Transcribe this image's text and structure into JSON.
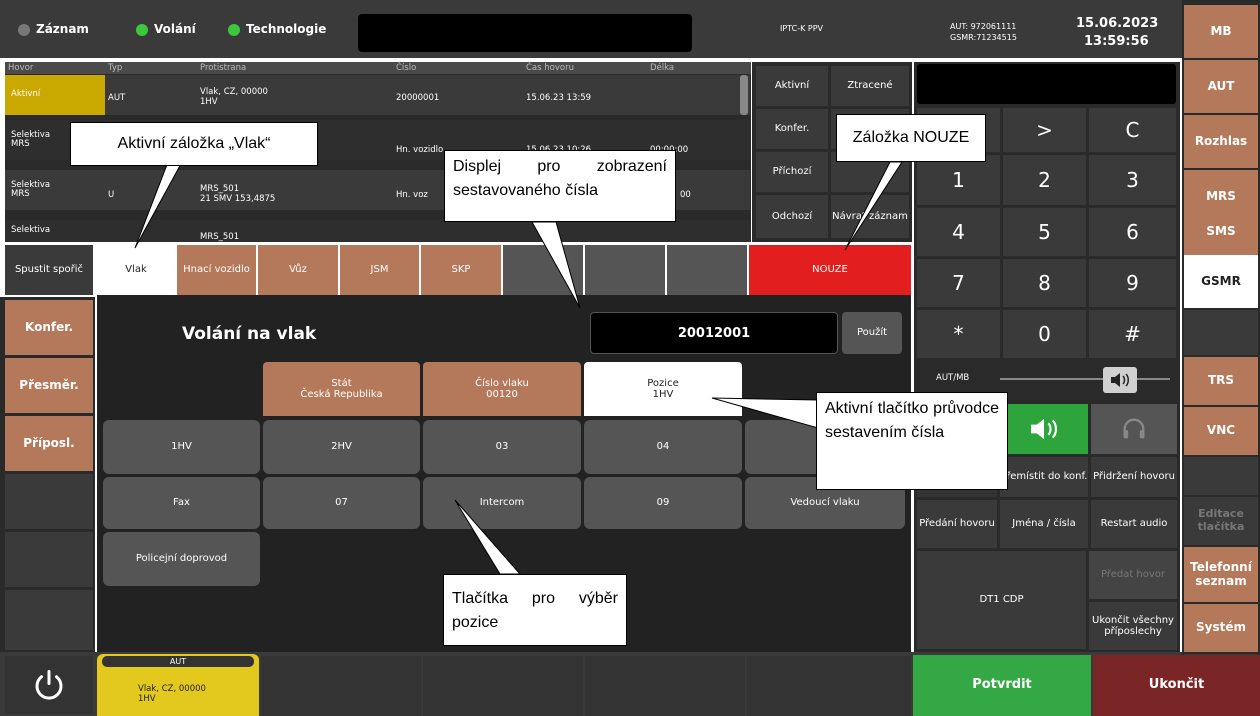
{
  "topbar": {
    "tabs": [
      {
        "label": "Záznam",
        "color": "#777777"
      },
      {
        "label": "Volání",
        "color": "#3cc83c"
      },
      {
        "label": "Technologie",
        "color": "#3cc83c"
      }
    ],
    "center_label": "IPTC-K PPV",
    "aut_line1": "AUT: 972061111",
    "aut_line2": "GSMR:71234515",
    "date": "15.06.2023",
    "time": "13:59:56"
  },
  "calls": {
    "headers": [
      "Hovor",
      "Typ",
      "Protistrana",
      "Číslo",
      "Čas hovoru",
      "Délka"
    ],
    "rows": [
      {
        "hovor": "Aktivní",
        "typ": "AUT",
        "protistrana": "Vlak, CZ, 00000",
        "protistrana2": "1HV",
        "cislo": "20000001",
        "cas": "15.06.23 13:59",
        "delka": ""
      },
      {
        "hovor": "Selektiva MRS",
        "typ": "",
        "protistrana": "",
        "protistrana2": "",
        "cislo": "Hn. vozidlo",
        "cas": "15.06.23 10:26",
        "delka": "00:00:00"
      },
      {
        "hovor": "Selektiva MRS",
        "typ": "U",
        "protistrana": "MRS_501",
        "protistrana2": "21 SMV 153,4875",
        "cislo": "Hn. voz",
        "cas": "",
        "delka": "00"
      },
      {
        "hovor": "Selektiva",
        "typ": "",
        "protistrana": "MRS_501",
        "protistrana2": "",
        "cislo": "",
        "cas": "",
        "delka": ""
      }
    ]
  },
  "filters": {
    "aktivni": "Aktivní",
    "ztracene": "Ztracené",
    "konfer": "Konfer.",
    "prichozi": "Příchozí",
    "odchozi": "Odchozí",
    "navrat": "Návrat záznam"
  },
  "keypad": {
    "keys": [
      ">",
      "C",
      "1",
      "2",
      "3",
      "4",
      "5",
      "6",
      "7",
      "8",
      "9",
      "*",
      "0",
      "#"
    ]
  },
  "right_menu": {
    "items": [
      "MB",
      "AUT",
      "Rozhlas",
      "MRS",
      "SMS",
      "GSMR",
      "",
      "TRS",
      "VNC",
      "",
      "Editace tlačítka",
      "Telefonní seznam",
      "Systém"
    ]
  },
  "tabs": {
    "spustit": "Spustit spořič",
    "items": [
      "Vlak",
      "Hnací vozidlo",
      "Vůz",
      "JSM",
      "SKP"
    ],
    "nouze": "NOUZE"
  },
  "left_menu": {
    "items": [
      "Konfer.",
      "Přesměr.",
      "Příposl."
    ]
  },
  "main": {
    "title": "Volání na vlak",
    "number": "20012001",
    "pouzit": "Použít",
    "stat_label": "Stát",
    "stat_value": "Česká Republika",
    "cislo_label": "Číslo vlaku",
    "cislo_value": "00120",
    "pozice_label": "Pozice",
    "pozice_value": "1HV",
    "positions": [
      "1HV",
      "2HV",
      "03",
      "04",
      "Fax",
      "07",
      "Intercom",
      "09",
      "Vedoucí vlaku",
      "Policejní doprovod"
    ]
  },
  "audio": {
    "label": "AUT/MB",
    "premistit": "Přemístit do konf.",
    "pridrzeni": "Přidržení hovoru",
    "predani": "Předání hovoru",
    "jmena": "Jména / čísla",
    "restart": "Restart audio",
    "dt1": "DT1 CDP",
    "predat": "Předat hovor",
    "ukoncit_vse": "Ukončit všechny příposlechy"
  },
  "bottom": {
    "call_badge": "AUT",
    "call_line1": "Vlak, CZ, 00000",
    "call_line2": "1HV",
    "potvrdit": "Potvrdit",
    "ukoncit": "Ukončit"
  },
  "annotations": {
    "vlak": "Aktivní záložka „Vlak“",
    "displej": "Displej pro zobrazení sestavovaného čísla",
    "nouze": "Záložka NOUZE",
    "pruvodce": "Aktivní tlačítko průvodce sestavením čísla",
    "pozice": "Tlačítka pro výběr pozice"
  }
}
